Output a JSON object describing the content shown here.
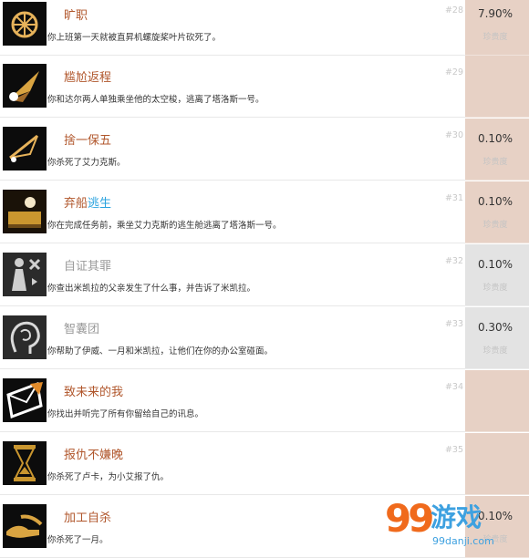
{
  "achievements": [
    {
      "title": "旷职",
      "desc": "你上班第一天就被直昇机螺旋桨叶片砍死了。",
      "num": "#28",
      "pct": "7.90%",
      "rare": "珍贵度",
      "icon": "wheel-icon"
    },
    {
      "title": "尴尬返程",
      "desc": "你和达尔两人单独乘坐他的太空梭，逃离了塔洛斯一号。",
      "num": "#29",
      "pct": "",
      "rare": "",
      "icon": "shuttle-icon"
    },
    {
      "title": "捨一保五",
      "desc": "你杀死了艾力克斯。",
      "num": "#30",
      "pct": "0.10%",
      "rare": "珍贵度",
      "icon": "scale-icon"
    },
    {
      "title_main": "弃船",
      "title_hl": "逃生",
      "desc": "你在完成任务前，乘坐艾力克斯的逃生舱逃离了塔洛斯一号。",
      "num": "#31",
      "pct": "0.10%",
      "rare": "珍贵度",
      "icon": "escape-pod-icon"
    },
    {
      "title": "自证其罪",
      "desc": "你查出米凯拉的父亲发生了什么事，并告诉了米凯拉。",
      "num": "#32",
      "pct": "0.10%",
      "rare": "珍贵度",
      "icon": "figure-icon"
    },
    {
      "title": "智囊团",
      "desc": "你帮助了伊威、一月和米凯拉，让他们在你的办公室碰面。",
      "num": "#33",
      "pct": "0.30%",
      "rare": "珍贵度",
      "icon": "brain-icon"
    },
    {
      "title": "致未来的我",
      "desc": "你找出并听完了所有你留给自己的讯息。",
      "num": "#34",
      "pct": "",
      "rare": "",
      "icon": "envelope-icon"
    },
    {
      "title": "报仇不嫌晚",
      "desc": "你杀死了卢卡，为小艾报了仇。",
      "num": "#35",
      "pct": "",
      "rare": "",
      "icon": "hourglass-icon"
    },
    {
      "title": "加工自杀",
      "desc": "你杀死了一月。",
      "num": "",
      "pct": "0.10%",
      "rare": "珍贵度",
      "icon": "hands-icon"
    }
  ],
  "colors": {
    "title": "#b0562b",
    "highlight": "#2aa3df",
    "side_warm": "#e7d1c5",
    "side_grey": "#e3e3e3",
    "brand_orange": "#f06a1c",
    "brand_blue": "#3ea1e0"
  },
  "watermark": {
    "num": "99",
    "text": "游戏",
    "site": "99danji.com"
  }
}
